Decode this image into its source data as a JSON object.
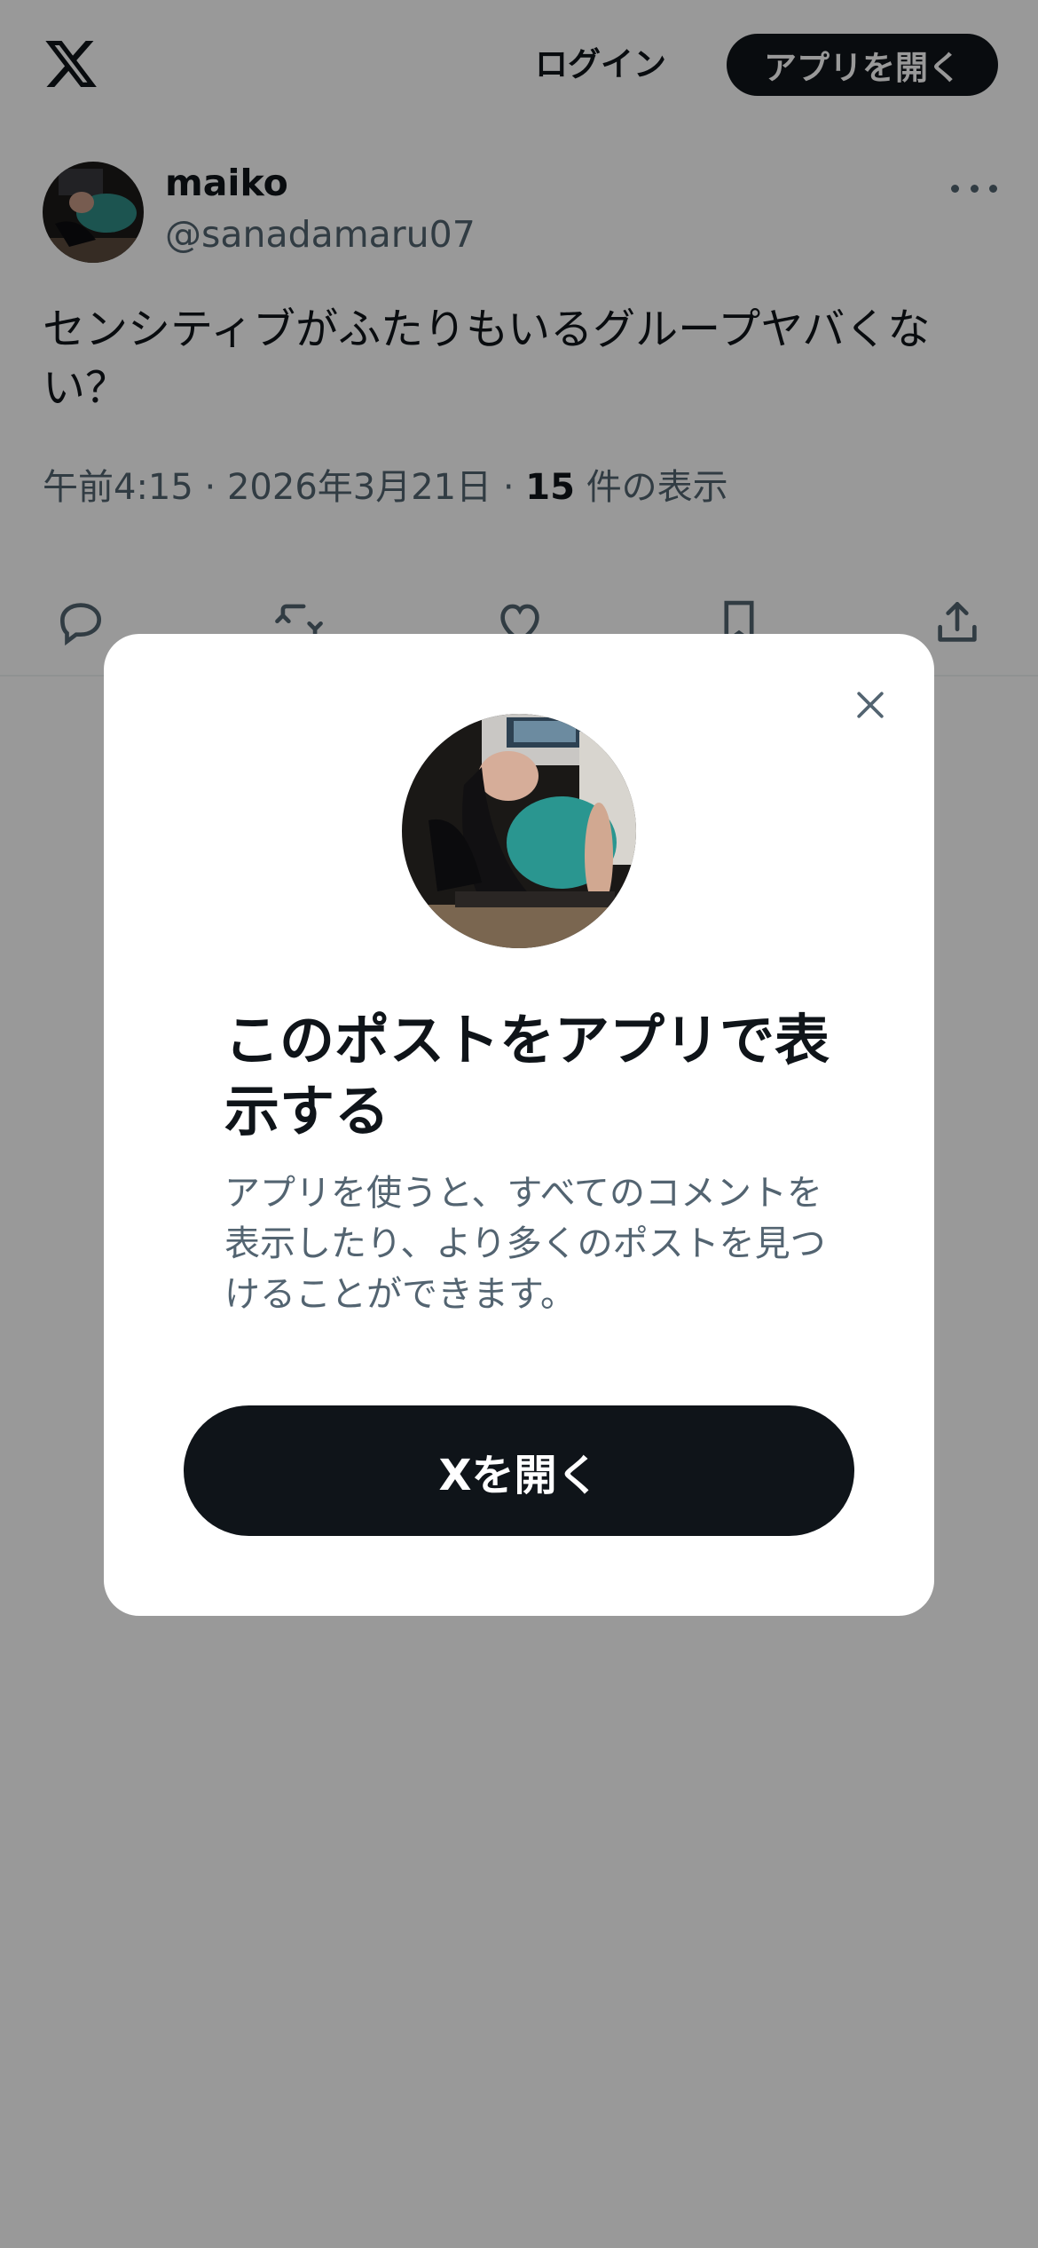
{
  "header": {
    "logo_icon": "x-logo-icon",
    "login_label": "ログイン",
    "open_app_label": "アプリを開く"
  },
  "post": {
    "author_name": "maiko",
    "author_handle": "@sanadamaru07",
    "text": "センシティブがふたりもいるグループヤバくない？",
    "time": "午前4:15",
    "date": "2026年3月21日",
    "views_count": "15",
    "views_label": "件の表示"
  },
  "actions": {
    "icons": [
      "reply-icon",
      "repost-icon",
      "like-icon",
      "bookmark-icon",
      "share-icon"
    ]
  },
  "modal": {
    "title": "このポストをアプリで表示する",
    "description": "アプリを使うと、すべてのコメントを表示したり、より多くのポストを見つけることができます。",
    "button_label": "Xを開く",
    "close_icon": "close-icon"
  },
  "colors": {
    "primary_text": "#0f1419",
    "secondary_text": "#536471",
    "button_bg": "#0f1419",
    "overlay": "rgba(0,0,0,0.4)"
  }
}
